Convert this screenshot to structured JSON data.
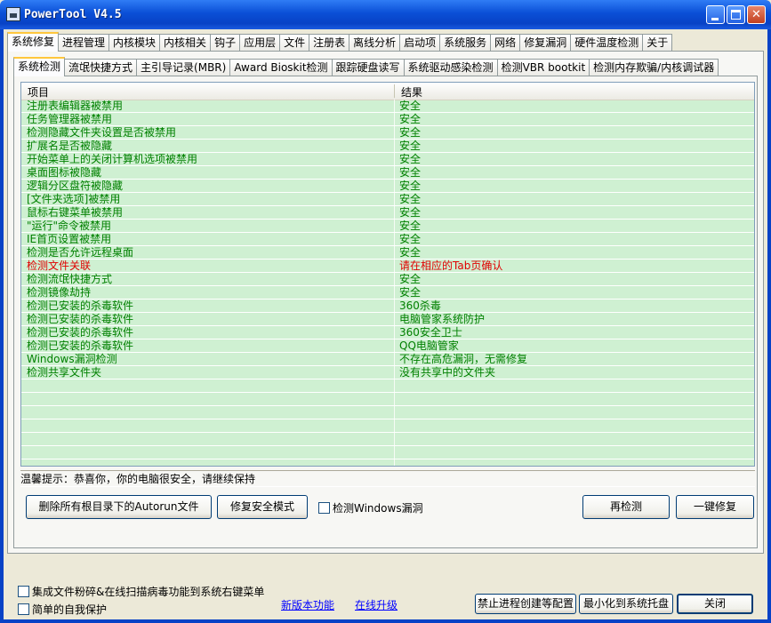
{
  "window": {
    "title": "PowerTool V4.5"
  },
  "main_tabs": [
    "系统修复",
    "进程管理",
    "内核模块",
    "内核相关",
    "钩子",
    "应用层",
    "文件",
    "注册表",
    "离线分析",
    "启动项",
    "系统服务",
    "网络",
    "修复漏洞",
    "硬件温度检测",
    "关于"
  ],
  "sub_tabs": [
    "系统检测",
    "流氓快捷方式",
    "主引导记录(MBR)",
    "Award Bioskit检测",
    "跟踪硬盘读写",
    "系统驱动感染检测",
    "检测VBR bootkit",
    "检测内存欺骗/内核调试器"
  ],
  "list": {
    "headers": [
      "项目",
      "结果"
    ],
    "rows": [
      {
        "item": "注册表编辑器被禁用",
        "result": "安全",
        "color": "#008000"
      },
      {
        "item": "任务管理器被禁用",
        "result": "安全",
        "color": "#008000"
      },
      {
        "item": "检测隐藏文件夹设置是否被禁用",
        "result": "安全",
        "color": "#008000"
      },
      {
        "item": "扩展名是否被隐藏",
        "result": "安全",
        "color": "#008000"
      },
      {
        "item": "开始菜单上的关闭计算机选项被禁用",
        "result": "安全",
        "color": "#008000"
      },
      {
        "item": "桌面图标被隐藏",
        "result": "安全",
        "color": "#008000"
      },
      {
        "item": "逻辑分区盘符被隐藏",
        "result": "安全",
        "color": "#008000"
      },
      {
        "item": "[文件夹选项]被禁用",
        "result": "安全",
        "color": "#008000"
      },
      {
        "item": "鼠标右键菜单被禁用",
        "result": "安全",
        "color": "#008000"
      },
      {
        "item": "\"运行\"命令被禁用",
        "result": "安全",
        "color": "#008000"
      },
      {
        "item": "IE首页设置被禁用",
        "result": "安全",
        "color": "#008000"
      },
      {
        "item": "检测是否允许远程桌面",
        "result": "安全",
        "color": "#008000"
      },
      {
        "item": "检测文件关联",
        "result": "请在相应的Tab页确认",
        "color": "#E00000"
      },
      {
        "item": "检测流氓快捷方式",
        "result": "安全",
        "color": "#008000"
      },
      {
        "item": "检测镜像劫持",
        "result": "安全",
        "color": "#008000"
      },
      {
        "item": "检测已安装的杀毒软件",
        "result": "360杀毒",
        "color": "#008000"
      },
      {
        "item": "检测已安装的杀毒软件",
        "result": "电脑管家系统防护",
        "color": "#008000"
      },
      {
        "item": "检测已安装的杀毒软件",
        "result": "360安全卫士",
        "color": "#008000"
      },
      {
        "item": "检测已安装的杀毒软件",
        "result": "QQ电脑管家",
        "color": "#008000"
      },
      {
        "item": "Windows漏洞检测",
        "result": "不存在高危漏洞，无需修复",
        "color": "#008000"
      },
      {
        "item": "检测共享文件夹",
        "result": "没有共享中的文件夹",
        "color": "#008000"
      }
    ]
  },
  "hint": "温馨提示：恭喜你，你的电脑很安全，请继续保持",
  "buttons": {
    "delete_autorun": "删除所有根目录下的Autorun文件",
    "repair_safe_mode": "修复安全模式",
    "recheck": "再检测",
    "one_click_fix": "一键修复",
    "forbid_process": "禁止进程创建等配置",
    "minimize_tray": "最小化到系统托盘",
    "close": "关闭"
  },
  "checkboxes": {
    "detect_windows_vuln": "检测Windows漏洞",
    "integrate_menu": "集成文件粉碎&在线扫描病毒功能到系统右键菜单",
    "self_protect": "简单的自我保护"
  },
  "links": {
    "new_features": "新版本功能",
    "online_upgrade": "在线升级"
  },
  "colors": {
    "list_bg": "#CFF0D2",
    "safe": "#008000",
    "warning": "#E00000"
  }
}
